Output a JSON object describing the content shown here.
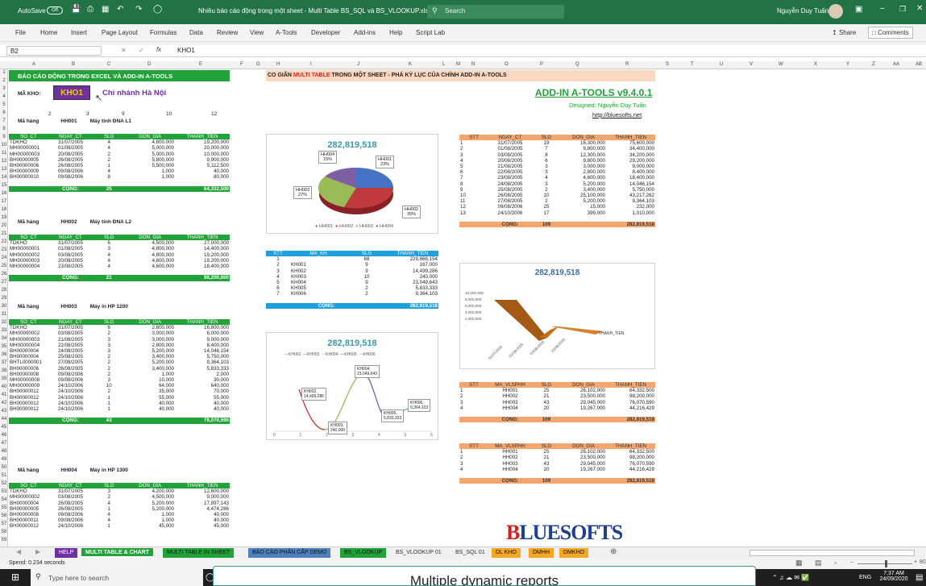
{
  "titlebar": {
    "autosave": "AutoSave",
    "autosave_state": "Off",
    "doc_title": "Nhiều báo cáo động trong một sheet - Multi Table BS_SQL và BS_VLOOKUP.xlsx",
    "search": "Search",
    "user": "Nguyễn Duy Tuấn"
  },
  "menu": [
    "File",
    "Home",
    "Insert",
    "Page Layout",
    "Formulas",
    "Data",
    "Review",
    "View",
    "A-Tools",
    "Developer",
    "Add-ins",
    "Help",
    "Script Lab"
  ],
  "share": "Share",
  "comments": "Comments",
  "formula": {
    "cell": "B2",
    "value": "KHO1"
  },
  "columns": [
    "A",
    "B",
    "C",
    "D",
    "E",
    "F",
    "G",
    "H",
    "I",
    "J",
    "K",
    "L",
    "M",
    "N",
    "O",
    "P",
    "Q",
    "R",
    "S",
    "T",
    "U",
    "V",
    "W",
    "X",
    "Y",
    "Z",
    "AA",
    "AB"
  ],
  "rows": [
    "1",
    "2",
    "3",
    "4",
    "5",
    "6",
    "7",
    "8",
    "9",
    "10",
    "11",
    "12",
    "13",
    "14",
    "15",
    "16",
    "17",
    "18",
    "19",
    "20",
    "21",
    "22",
    "23",
    "24",
    "25",
    "26",
    "27",
    "28",
    "29",
    "30",
    "31",
    "32",
    "33",
    "34",
    "35",
    "36",
    "37",
    "38",
    "39",
    "40",
    "41",
    "42",
    "43",
    "44",
    "45",
    "46",
    "47",
    "48",
    "49",
    "50",
    "51",
    "52",
    "53",
    "54",
    "55",
    "56",
    "57",
    "58",
    "59"
  ],
  "left": {
    "banner": "BÁO CÁO ĐỘNG TRONG EXCEL VÀ ADD-IN A-TOOLS",
    "ma_kho_label": "MÃ KHO:",
    "ma_kho": "KHO1",
    "chi_nhanh": "Chi nhánh Hà Nội",
    "numrow": [
      "2",
      "3",
      "9",
      "10",
      "12"
    ],
    "mahang_label": "Mã hàng",
    "cong": "CỘNG:",
    "headers": [
      "SO_CT",
      "NGAY_CT",
      "SLG",
      "DON_GIA",
      "THANH_TIEN"
    ],
    "groups": [
      {
        "code": "HH001",
        "name": "Máy tính ĐNA L1",
        "rows": [
          [
            "TDKHO",
            "31/07/2005",
            "4",
            "4,800,000",
            "19,200,000"
          ],
          [
            "MH00000001",
            "01/08/2005",
            "4",
            "5,000,000",
            "20,000,000"
          ],
          [
            "MH00000003",
            "20/08/2005",
            "2",
            "5,000,000",
            "10,000,000"
          ],
          [
            "BH00000005",
            "26/08/2005",
            "2",
            "5,800,000",
            "9,900,000"
          ],
          [
            "BH00000006",
            "26/08/2005",
            "1",
            "5,500,000",
            "5,112,500"
          ],
          [
            "BH00000009",
            "09/08/2006",
            "4",
            "1,000",
            "40,000"
          ],
          [
            "BH00000010",
            "09/08/2006",
            "8",
            "1,000",
            "80,000"
          ]
        ],
        "sum_slg": "25",
        "sum_tt": "64,332,500"
      },
      {
        "code": "HH002",
        "name": "Máy tính ĐNA L2",
        "rows": [
          [
            "TDKHO",
            "31/07/2005",
            "6",
            "4,500,000",
            "27,000,000"
          ],
          [
            "MH00000001",
            "01/08/2005",
            "3",
            "4,800,000",
            "14,400,000"
          ],
          [
            "MH00000002",
            "03/08/2005",
            "4",
            "4,800,000",
            "19,200,000"
          ],
          [
            "MH00000003",
            "20/08/2005",
            "4",
            "4,800,000",
            "19,200,000"
          ],
          [
            "MH00000004",
            "23/08/2005",
            "4",
            "4,600,000",
            "18,400,000"
          ]
        ],
        "sum_slg": "21",
        "sum_tt": "98,200,000"
      },
      {
        "code": "HH003",
        "name": "Máy in HP 1200",
        "rows": [
          [
            "TDKHO",
            "31/07/2005",
            "6",
            "2,800,000",
            "16,800,000"
          ],
          [
            "MH00000002",
            "03/08/2005",
            "2",
            "3,000,000",
            "6,000,000"
          ],
          [
            "MH00000003",
            "21/08/2005",
            "3",
            "3,000,000",
            "9,000,000"
          ],
          [
            "MH00000004",
            "22/08/2005",
            "3",
            "2,800,000",
            "8,400,000"
          ],
          [
            "BH00000004",
            "24/08/2005",
            "3",
            "5,200,000",
            "14,046,154"
          ],
          [
            "BH00000004",
            "25/08/2005",
            "2",
            "3,400,000",
            "5,750,000"
          ],
          [
            "BHTL0000001",
            "27/08/2005",
            "2",
            "5,200,000",
            "9,364,103"
          ],
          [
            "BH00000006",
            "26/08/2005",
            "2",
            "3,400,000",
            "5,833,333"
          ],
          [
            "BH00000008",
            "09/08/2006",
            "2",
            "1,000",
            "2,000"
          ],
          [
            "MH00000008",
            "09/08/2006",
            "3",
            "10,000",
            "30,000"
          ],
          [
            "MH00000009",
            "24/10/2006",
            "10",
            "64,000",
            "640,000"
          ],
          [
            "BH00000012",
            "24/10/2006",
            "2",
            "35,000",
            "70,000"
          ],
          [
            "BH00000012",
            "24/10/2006",
            "1",
            "55,000",
            "55,000"
          ],
          [
            "BH00000012",
            "24/10/2006",
            "1",
            "40,000",
            "40,000"
          ],
          [
            "BH00000012",
            "24/10/2006",
            "1",
            "40,000",
            "40,000"
          ]
        ],
        "sum_slg": "43",
        "sum_tt": "76,070,590"
      },
      {
        "code": "HH004",
        "name": "Máy in HP 1300",
        "rows": [
          [
            "TDKHO",
            "31/07/2005",
            "3",
            "4,200,000",
            "12,600,000"
          ],
          [
            "MH00000002",
            "03/08/2005",
            "2",
            "4,500,000",
            "9,000,000"
          ],
          [
            "BH00000004",
            "26/08/2005",
            "4",
            "5,200,000",
            "17,897,143"
          ],
          [
            "BH00000005",
            "26/08/2005",
            "1",
            "5,200,000",
            "4,474,286"
          ],
          [
            "BH00000008",
            "09/08/2006",
            "4",
            "1,000",
            "40,000"
          ],
          [
            "BH00000011",
            "09/08/2006",
            "4",
            "1,000",
            "40,000"
          ],
          [
            "BH00000012",
            "24/10/2006",
            "1",
            "45,000",
            "45,000"
          ]
        ],
        "sum_slg": "",
        "sum_tt": ""
      }
    ]
  },
  "middle": {
    "banner_pre": "CO GIÃN ",
    "banner_red": "MULTI TABLE",
    "banner_post": " TRONG MỘT SHEET - PHÁ KỶ LỤC CỦA CHÍNH ADD-IN A-TOOLS",
    "pie": {
      "title": "282,819,518",
      "legend": [
        "HH001",
        "HH002",
        "HH003",
        "HH004"
      ],
      "labels": [
        {
          "t": "HH001",
          "p": "23%"
        },
        {
          "t": "HH002",
          "p": "35%"
        },
        {
          "t": "HH003",
          "p": "27%"
        },
        {
          "t": "HH004",
          "p": "15%"
        }
      ]
    },
    "kh": {
      "headers": [
        "STT",
        "MA_KH",
        "SLG",
        "THANH_TIEN"
      ],
      "rows": [
        [
          "1",
          "",
          "68",
          "229,666,154"
        ],
        [
          "2",
          "KH001",
          "9",
          "167,000"
        ],
        [
          "3",
          "KH002",
          "9",
          "14,499,286"
        ],
        [
          "4",
          "KH003",
          "10",
          "240,000"
        ],
        [
          "5",
          "KH004",
          "9",
          "23,049,643"
        ],
        [
          "6",
          "KH005",
          "2",
          "5,833,333"
        ],
        [
          "7",
          "KH006",
          "2",
          "9,364,103"
        ]
      ],
      "cong": "CỘNG:",
      "total": "282,819,518"
    },
    "line": {
      "title": "282,819,518",
      "legend": [
        "KH002",
        "KH003",
        "KH004",
        "KH005",
        "KH006"
      ],
      "callouts": [
        {
          "t": "KH002,",
          "v": "14,499,286"
        },
        {
          "t": "KH004,",
          "v": "23,049,643"
        },
        {
          "t": "KH003,",
          "v": "240,000"
        },
        {
          "t": "KH005,",
          "v": "5,833,333"
        },
        {
          "t": "KH006,",
          "v": "9,364,103"
        }
      ],
      "xticks": [
        "0",
        "1",
        "2",
        "3",
        "4",
        "5",
        "6"
      ]
    }
  },
  "right": {
    "brand": "ADD-IN A-TOOLS v9.4.0.1",
    "designed": "Designed: Nguyễn Duy Tuấn",
    "url": "http://bluesofts.net",
    "t1": {
      "headers": [
        "STT",
        "NGAY_CT",
        "SLG",
        "DON_GIA",
        "THANH_TIEN"
      ],
      "rows": [
        [
          "1",
          "31/07/2005",
          "19",
          "16,300,000",
          "75,600,000"
        ],
        [
          "2",
          "01/08/2005",
          "7",
          "9,800,000",
          "34,400,000"
        ],
        [
          "3",
          "03/08/2005",
          "8",
          "12,300,000",
          "34,200,000"
        ],
        [
          "4",
          "20/08/2005",
          "6",
          "9,800,000",
          "29,200,000"
        ],
        [
          "5",
          "21/08/2005",
          "3",
          "3,000,000",
          "9,000,000"
        ],
        [
          "6",
          "22/08/2005",
          "3",
          "2,800,000",
          "8,400,000"
        ],
        [
          "7",
          "23/08/2005",
          "4",
          "4,600,000",
          "18,400,000"
        ],
        [
          "8",
          "24/08/2005",
          "3",
          "5,200,000",
          "14,046,154"
        ],
        [
          "9",
          "25/08/2005",
          "2",
          "3,400,000",
          "5,750,000"
        ],
        [
          "10",
          "26/08/2005",
          "10",
          "25,100,000",
          "43,217,262"
        ],
        [
          "11",
          "27/08/2005",
          "2",
          "5,200,000",
          "9,364,103"
        ],
        [
          "12",
          "09/08/2006",
          "25",
          "15,000",
          "232,000"
        ],
        [
          "13",
          "24/10/2006",
          "17",
          "399,000",
          "1,010,000"
        ]
      ],
      "cong": "CỘNG:",
      "slg": "109",
      "total": "282,819,518"
    },
    "chart3d": {
      "title": "282,819,518",
      "yticks": [
        "10,000,000",
        "8,000,000",
        "6,000,000",
        "4,000,000",
        "2,000,000",
        "-"
      ],
      "xticks": [
        "31/07/2005",
        "01/08/2005",
        "03/08/2005",
        "20/08/2005"
      ],
      "series": "THANH_TIEN"
    },
    "t2": {
      "headers": [
        "STT",
        "MA_VLSPHH",
        "SLG",
        "DON_GIA",
        "THANH_TIEN"
      ],
      "rows": [
        [
          "1",
          "HH001",
          "25",
          "26,102,000",
          "64,332,500"
        ],
        [
          "2",
          "HH002",
          "21",
          "23,500,000",
          "98,200,000"
        ],
        [
          "3",
          "HH003",
          "43",
          "29,045,000",
          "76,070,590"
        ],
        [
          "4",
          "HH004",
          "20",
          "19,267,000",
          "44,216,429"
        ]
      ],
      "cong": "CỘNG:",
      "slg": "109",
      "total": "282,819,518"
    },
    "t3": {
      "headers": [
        "STT",
        "MA_VLSPHH",
        "SLG",
        "DON_GIA",
        "THANH_TIEN"
      ],
      "rows": [
        [
          "1",
          "HH001",
          "25",
          "26,102,000",
          "64,332,500"
        ],
        [
          "2",
          "HH002",
          "21",
          "23,500,000",
          "98,200,000"
        ],
        [
          "3",
          "HH003",
          "43",
          "29,045,000",
          "76,070,590"
        ],
        [
          "4",
          "HH004",
          "20",
          "19,267,000",
          "44,216,429"
        ]
      ],
      "cong": "CỘNG:",
      "slg": "109",
      "total": "282,819,518"
    },
    "logo": "BLUESOFTS"
  },
  "tabs": [
    {
      "label": "HELP",
      "bg": "#7030a0",
      "fg": "#ffffff"
    },
    {
      "label": "MULTI TABLE & CHART",
      "bg": "#21a33a",
      "fg": "#ffffff",
      "active": true
    },
    {
      "label": "MULTI TABLE IN SHEET",
      "bg": "#21a33a",
      "fg": "#111111"
    },
    {
      "label": "BÁO CÁO PHÂN CẤP DEMO",
      "bg": "#4f81bd",
      "fg": "#111111"
    },
    {
      "label": "BS_VLOOKUP",
      "bg": "#21a33a",
      "fg": "#111111"
    },
    {
      "label": "BS_VLOOKUP 01",
      "bg": "#f0f0f0",
      "fg": "#333333"
    },
    {
      "label": "BS_SQL 01",
      "bg": "#f0f0f0",
      "fg": "#333333"
    },
    {
      "label": "DL KHO",
      "bg": "#f5a623",
      "fg": "#111111"
    },
    {
      "label": "DMHH",
      "bg": "#f5a623",
      "fg": "#111111"
    },
    {
      "label": "DMKHO",
      "bg": "#f5a623",
      "fg": "#111111"
    }
  ],
  "status": {
    "left": "Spend: 0.234 seconds",
    "zoom": "80%"
  },
  "taskbar": {
    "search": "Type here to search",
    "time": "7:37 AM",
    "date": "24/09/2020",
    "lang": "ENG"
  },
  "caption": "Multiple dynamic reports"
}
